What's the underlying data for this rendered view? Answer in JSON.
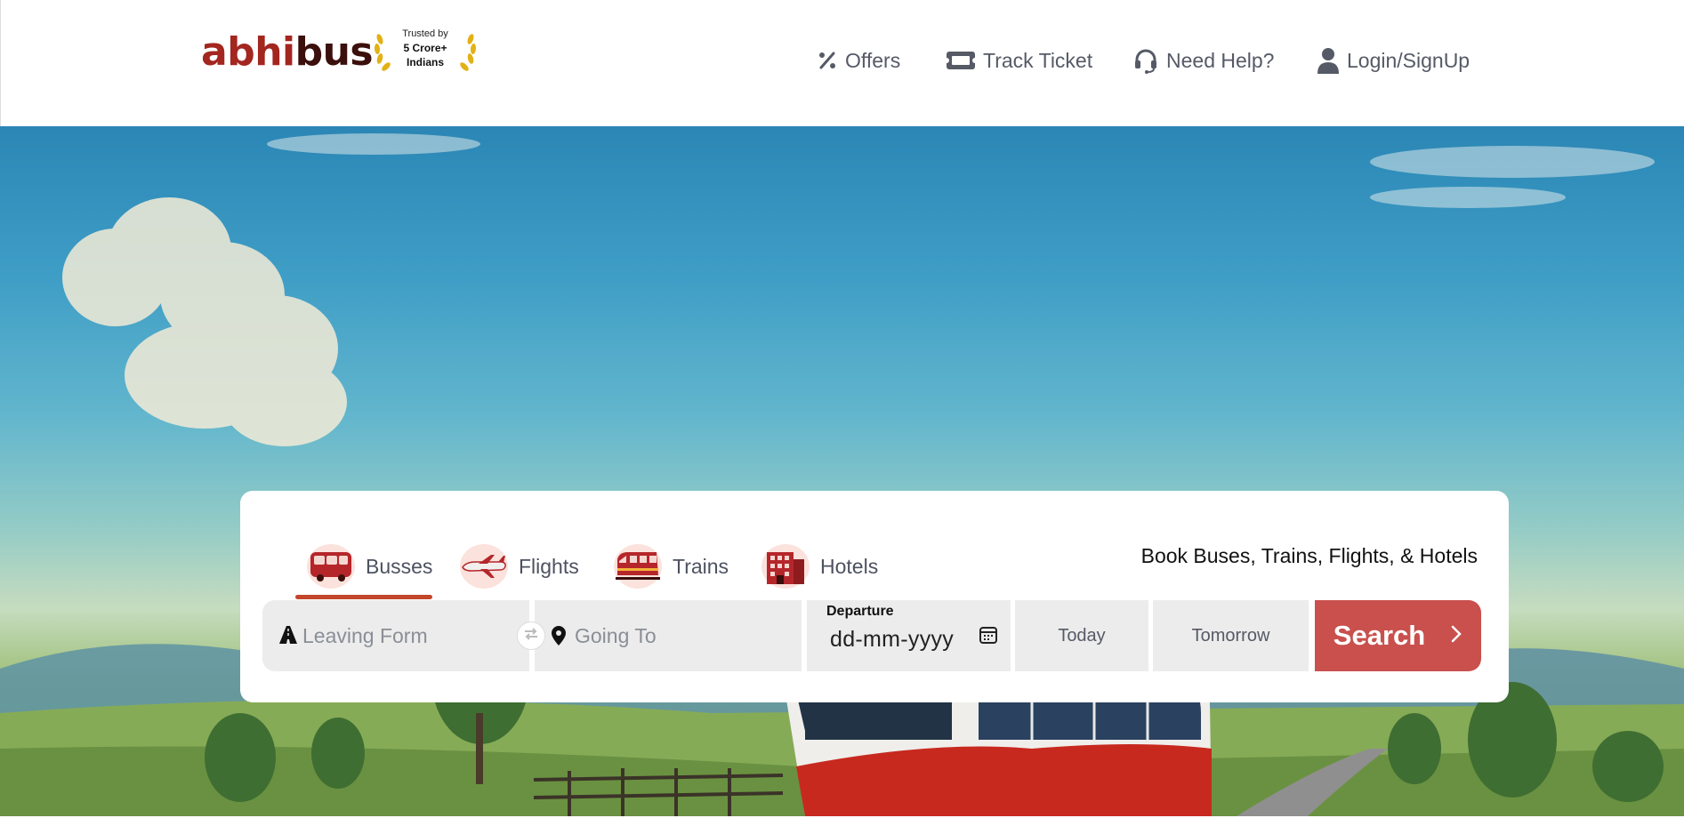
{
  "header": {
    "logo": {
      "part1": "abhi",
      "part2": "bus"
    },
    "trust_badge": {
      "line1": "Trusted by",
      "line2": "5 Crore+",
      "line3": "Indians"
    },
    "nav": [
      {
        "label": "Offers",
        "icon": "percent-icon"
      },
      {
        "label": "Track Ticket",
        "icon": "ticket-icon"
      },
      {
        "label": "Need Help?",
        "icon": "headset-icon"
      },
      {
        "label": "Login/SignUp",
        "icon": "user-icon"
      }
    ]
  },
  "search_card": {
    "tabs": [
      {
        "label": "Busses",
        "icon": "bus-icon",
        "active": true
      },
      {
        "label": "Flights",
        "icon": "flight-icon",
        "active": false
      },
      {
        "label": "Trains",
        "icon": "train-icon",
        "active": false
      },
      {
        "label": "Hotels",
        "icon": "hotel-icon",
        "active": false
      }
    ],
    "tagline": "Book Buses, Trains, Flights, & Hotels",
    "from": {
      "placeholder": "Leaving Form",
      "value": ""
    },
    "to": {
      "placeholder": "Going To",
      "value": ""
    },
    "departure": {
      "label": "Departure",
      "value": "dd-mm-yyyy"
    },
    "quick_dates": [
      "Today",
      "Tomorrow"
    ],
    "search_label": "Search"
  },
  "colors": {
    "brand_red": "#a3261f",
    "brand_dark": "#3a0f0c",
    "search_button": "#c9504d",
    "tab_underline": "#c2462a",
    "field_bg": "#ececec"
  }
}
